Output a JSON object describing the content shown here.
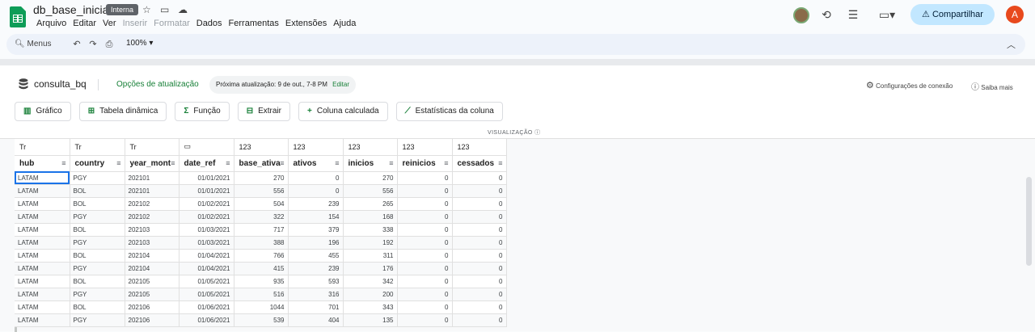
{
  "doc": {
    "title": "db_base_inicial",
    "badge": "Interna"
  },
  "menu": [
    "Arquivo",
    "Editar",
    "Ver",
    "Inserir",
    "Formatar",
    "Dados",
    "Ferramentas",
    "Extensões",
    "Ajuda"
  ],
  "share": {
    "label": "Compartilhar"
  },
  "user": {
    "initial": "A"
  },
  "toolbar": {
    "menus_label": "Menus",
    "zoom": "100%"
  },
  "connection": {
    "name": "consulta_bq",
    "update_options": "Opções de atualização",
    "next_update_label": "Próxima atualização:",
    "next_update_value": "9 de out., 7-8 PM",
    "edit": "Editar",
    "settings": "Configurações de conexão",
    "help": "Saiba mais"
  },
  "actions": [
    "Gráfico",
    "Tabela dinâmica",
    "Função",
    "Extrair",
    "Coluna calculada",
    "Estatísticas da coluna"
  ],
  "viz_label": "VISUALIZAÇÃO",
  "table": {
    "types": [
      "Tr",
      "Tr",
      "Tr",
      "",
      "123",
      "123",
      "123",
      "123",
      "123"
    ],
    "columns": [
      "hub",
      "country",
      "year_mont",
      "date_ref",
      "base_ativa",
      "ativos",
      "inicios",
      "reinicios",
      "cessados"
    ],
    "rows": [
      [
        "LATAM",
        "PGY",
        "202101",
        "01/01/2021",
        "270",
        "0",
        "270",
        "0",
        "0"
      ],
      [
        "LATAM",
        "BOL",
        "202101",
        "01/01/2021",
        "556",
        "0",
        "556",
        "0",
        "0"
      ],
      [
        "LATAM",
        "BOL",
        "202102",
        "01/02/2021",
        "504",
        "239",
        "265",
        "0",
        "0"
      ],
      [
        "LATAM",
        "PGY",
        "202102",
        "01/02/2021",
        "322",
        "154",
        "168",
        "0",
        "0"
      ],
      [
        "LATAM",
        "BOL",
        "202103",
        "01/03/2021",
        "717",
        "379",
        "338",
        "0",
        "0"
      ],
      [
        "LATAM",
        "PGY",
        "202103",
        "01/03/2021",
        "388",
        "196",
        "192",
        "0",
        "0"
      ],
      [
        "LATAM",
        "BOL",
        "202104",
        "01/04/2021",
        "766",
        "455",
        "311",
        "0",
        "0"
      ],
      [
        "LATAM",
        "PGY",
        "202104",
        "01/04/2021",
        "415",
        "239",
        "176",
        "0",
        "0"
      ],
      [
        "LATAM",
        "BOL",
        "202105",
        "01/05/2021",
        "935",
        "593",
        "342",
        "0",
        "0"
      ],
      [
        "LATAM",
        "PGY",
        "202105",
        "01/05/2021",
        "516",
        "316",
        "200",
        "0",
        "0"
      ],
      [
        "LATAM",
        "BOL",
        "202106",
        "01/06/2021",
        "1044",
        "701",
        "343",
        "0",
        "0"
      ],
      [
        "LATAM",
        "PGY",
        "202106",
        "01/06/2021",
        "539",
        "404",
        "135",
        "0",
        "0"
      ]
    ]
  }
}
